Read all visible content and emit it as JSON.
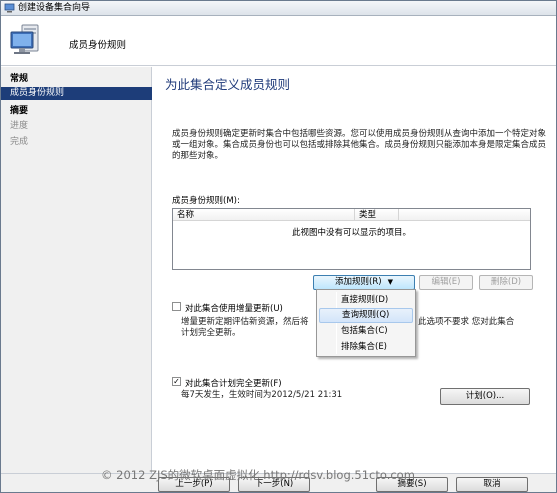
{
  "window": {
    "title": "创建设备集合向导"
  },
  "header": {
    "title": "成员身份规则"
  },
  "sidebar": {
    "items": [
      {
        "label": "常规"
      },
      {
        "label": "成员身份规则"
      },
      {
        "label": "摘要"
      },
      {
        "label": "进度"
      },
      {
        "label": "完成"
      }
    ]
  },
  "main": {
    "title": "为此集合定义成员规则",
    "description": "成员身份规则确定更新时集合中包括哪些资源。您可以使用成员身份规则从查询中添加一个特定对象或一组对象。集合成员身份也可以包括或排除其他集合。成员身份规则只能添加本身是限定集合成员的那些对象。",
    "rules_label": "成员身份规则(M):",
    "columns": [
      "名称",
      "类型"
    ],
    "empty_message": "此视图中没有可以显示的项目。",
    "add_rule_button": "添加规则(R)",
    "edit_button": "编辑(E)",
    "delete_button": "删除(D)",
    "incremental_checkbox": "对此集合使用增量更新(U)",
    "incremental_desc_left": "增量更新定期评估新资源，然后将",
    "incremental_desc_right": "此选项不要求 您对此集合",
    "incremental_desc_line2": "计划完全更新。",
    "schedule_checkbox": "对此集合计划完全更新(F)",
    "schedule_desc": "每7天发生，生效时间为2012/5/21 21:31",
    "schedule_button": "计划(O)..."
  },
  "add_rule_menu": {
    "items": [
      {
        "label": "直接规则(D)"
      },
      {
        "label": "查询规则(Q)"
      },
      {
        "label": "包括集合(C)"
      },
      {
        "label": "排除集合(E)"
      }
    ]
  },
  "footer": {
    "prev_button": "上一步(P)",
    "next_button": "下一步(N)",
    "summary_button": "摘要(S)",
    "cancel_button": "取消"
  },
  "watermark": "© 2012 ZJS的微软桌面虚拟化 http://rdsv.blog.51cto.com"
}
